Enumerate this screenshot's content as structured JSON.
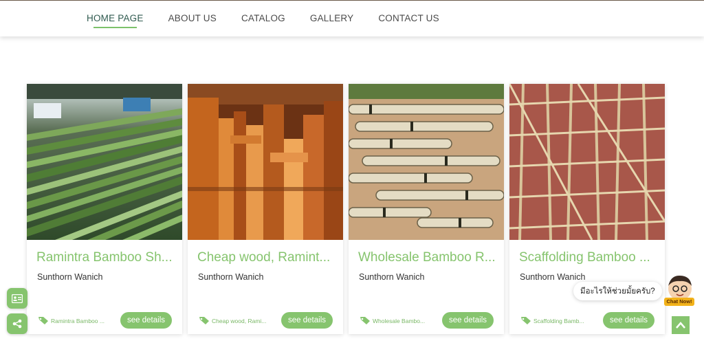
{
  "nav": {
    "items": [
      {
        "label": "HOME PAGE",
        "active": true
      },
      {
        "label": "ABOUT US"
      },
      {
        "label": "CATALOG"
      },
      {
        "label": "GALLERY"
      },
      {
        "label": "CONTACT US"
      }
    ]
  },
  "cards": [
    {
      "title": "Ramintra Bamboo Sh...",
      "author": "Sunthorn Wanich",
      "tag": "Ramintra Bamboo ...",
      "button": "see details",
      "image": "bamboo-stalks-photo"
    },
    {
      "title": "Cheap wood, Ramint...",
      "author": "Sunthorn Wanich",
      "tag": "Cheap wood, Rami...",
      "button": "see details",
      "image": "lumber-stacks-photo"
    },
    {
      "title": "Wholesale Bamboo R...",
      "author": "Sunthorn Wanich",
      "tag": "Wholesale Bambo...",
      "button": "see details",
      "image": "bamboo-bundles-photo"
    },
    {
      "title": "Scaffolding Bamboo ...",
      "author": "Sunthorn Wanich",
      "tag": "Scaffolding Bamb...",
      "button": "see details",
      "image": "bamboo-scaffolding-photo"
    }
  ],
  "chat": {
    "bubble": "มีอะไรให้ช่วยมั้ยครับ?",
    "label": "Chat Now!"
  },
  "icons": {
    "side_top": "contact-card-icon",
    "side_bottom": "share-icon",
    "to_top": "arrow-up-icon",
    "tag": "tag-icon"
  },
  "colors": {
    "accent": "#86c46e",
    "nav_active": "#2f5a4f",
    "chat_label": "#f2b21a"
  }
}
